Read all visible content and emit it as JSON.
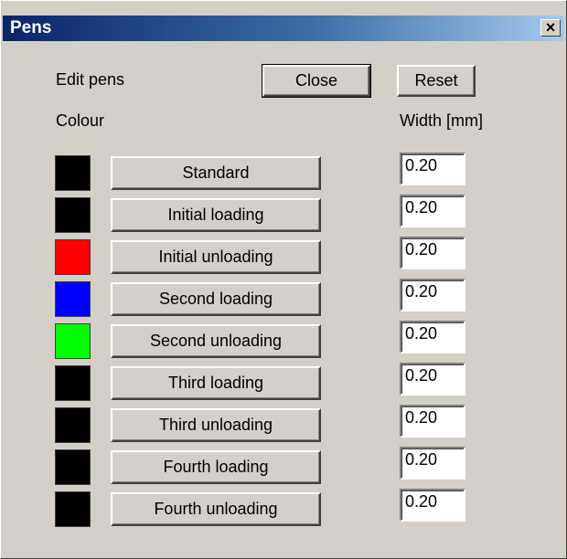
{
  "window": {
    "title": "Pens",
    "close_glyph": "×"
  },
  "labels": {
    "edit_pens": "Edit pens",
    "colour": "Colour",
    "width": "Width [mm]"
  },
  "buttons": {
    "close": "Close",
    "reset": "Reset"
  },
  "pens": [
    {
      "name": "Standard",
      "color": "#000000",
      "width": "0.20"
    },
    {
      "name": "Initial loading",
      "color": "#000000",
      "width": "0.20"
    },
    {
      "name": "Initial unloading",
      "color": "#ff0000",
      "width": "0.20"
    },
    {
      "name": "Second loading",
      "color": "#0000ff",
      "width": "0.20"
    },
    {
      "name": "Second unloading",
      "color": "#00ff00",
      "width": "0.20"
    },
    {
      "name": "Third loading",
      "color": "#000000",
      "width": "0.20"
    },
    {
      "name": "Third unloading",
      "color": "#000000",
      "width": "0.20"
    },
    {
      "name": "Fourth loading",
      "color": "#000000",
      "width": "0.20"
    },
    {
      "name": "Fourth unloading",
      "color": "#000000",
      "width": "0.20"
    }
  ]
}
